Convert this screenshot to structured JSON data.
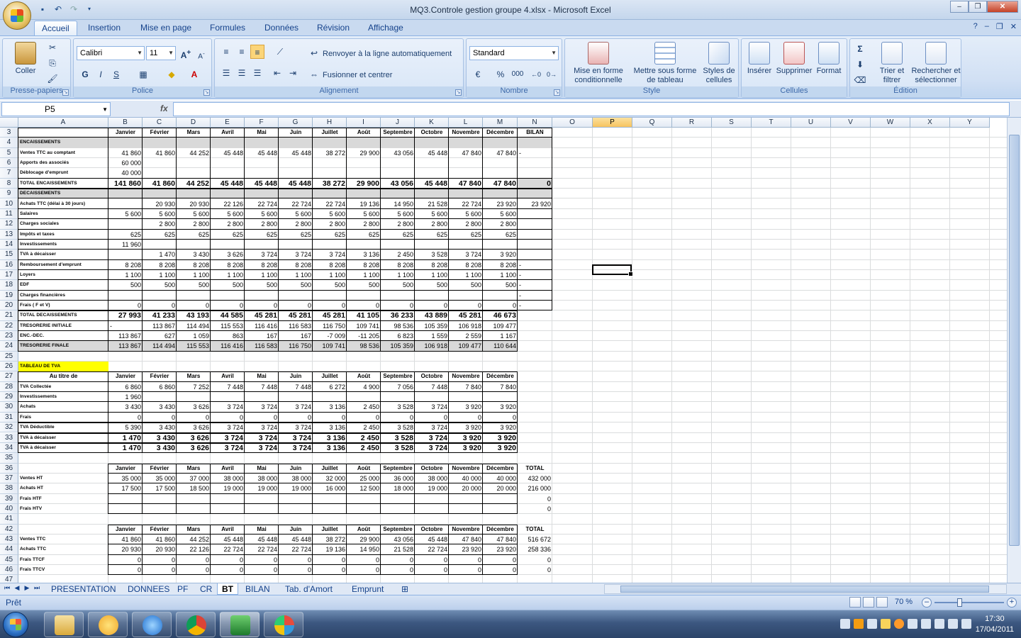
{
  "window": {
    "title": "MQ3.Controle gestion groupe 4.xlsx - Microsoft Excel"
  },
  "ribbon": {
    "tabs": [
      "Accueil",
      "Insertion",
      "Mise en page",
      "Formules",
      "Données",
      "Révision",
      "Affichage"
    ],
    "active_tab": "Accueil",
    "groups": {
      "clipboard": "Presse-papiers",
      "font": "Police",
      "alignment": "Alignement",
      "number": "Nombre",
      "style": "Style",
      "cells": "Cellules",
      "editing": "Édition"
    },
    "paste_label": "Coller",
    "font_name": "Calibri",
    "font_size": "11",
    "wrap_text": "Renvoyer à la ligne automatiquement",
    "merge_center": "Fusionner et centrer",
    "number_format": "Standard",
    "conditional_l1": "Mise en forme",
    "conditional_l2": "conditionnelle",
    "table_l1": "Mettre sous forme",
    "table_l2": "de tableau",
    "cellstyles_l1": "Styles de",
    "cellstyles_l2": "cellules",
    "insert": "Insérer",
    "delete": "Supprimer",
    "format": "Format",
    "sort_l1": "Trier et",
    "sort_l2": "filtrer",
    "find_l1": "Rechercher et",
    "find_l2": "sélectionner",
    "bold": "G",
    "italic": "I",
    "underline": "S",
    "percent": "%",
    "thousands": "000",
    "autosum": "Σ"
  },
  "formula_bar": {
    "name_box": "P5",
    "fx": "fx",
    "formula": ""
  },
  "columns": [
    "A",
    "B",
    "C",
    "D",
    "E",
    "F",
    "G",
    "H",
    "I",
    "J",
    "K",
    "L",
    "M",
    "N",
    "O",
    "P",
    "Q",
    "R",
    "S",
    "T",
    "U",
    "V",
    "W",
    "X",
    "Y"
  ],
  "selected_column": "P",
  "rows": [
    {
      "n": 3,
      "cells": {
        "B": "Janvier",
        "C": "Février",
        "D": "Mars",
        "E": "Avril",
        "F": "Mai",
        "G": "Juin",
        "H": "Juillet",
        "I": "Août",
        "J": "Septembre",
        "K": "Octobre",
        "L": "Novembre",
        "M": "Décembre",
        "N": "BILAN"
      },
      "hdr": true
    },
    {
      "n": 4,
      "cells": {
        "A": "ENCAISSEMENTS"
      }
    },
    {
      "n": 5,
      "cells": {
        "A": "Ventes TTC au comptant",
        "B": "41 860",
        "C": "41 860",
        "D": "44 252",
        "E": "45 448",
        "F": "45 448",
        "G": "45 448",
        "H": "38 272",
        "I": "29 900",
        "J": "43 056",
        "K": "45 448",
        "L": "47 840",
        "M": "47 840",
        "N": "-"
      }
    },
    {
      "n": 6,
      "cells": {
        "A": "Apports des associés",
        "B": "60 000"
      }
    },
    {
      "n": 7,
      "cells": {
        "A": "Déblocage d'emprunt",
        "B": "40 000"
      }
    },
    {
      "n": 8,
      "cells": {
        "A": "TOTAL ENCAISSEMENTS",
        "B": "141 860",
        "C": "41 860",
        "D": "44 252",
        "E": "45 448",
        "F": "45 448",
        "G": "45 448",
        "H": "38 272",
        "I": "29 900",
        "J": "43 056",
        "K": "45 448",
        "L": "47 840",
        "M": "47 840",
        "N": "0"
      },
      "bold": true
    },
    {
      "n": 9,
      "cells": {
        "A": "DECAISSEMENTS"
      }
    },
    {
      "n": 10,
      "cells": {
        "A": "Achats TTC (délai à 30 jours)",
        "C": "20 930",
        "D": "20 930",
        "E": "22 126",
        "F": "22 724",
        "G": "22 724",
        "H": "22 724",
        "I": "19 136",
        "J": "14 950",
        "K": "21 528",
        "L": "22 724",
        "M": "23 920",
        "N": "23 920"
      }
    },
    {
      "n": 11,
      "cells": {
        "A": "Salaires",
        "B": "5 600",
        "C": "5 600",
        "D": "5 600",
        "E": "5 600",
        "F": "5 600",
        "G": "5 600",
        "H": "5 600",
        "I": "5 600",
        "J": "5 600",
        "K": "5 600",
        "L": "5 600",
        "M": "5 600"
      }
    },
    {
      "n": 12,
      "cells": {
        "A": "Charges sociales",
        "C": "2 800",
        "D": "2 800",
        "E": "2 800",
        "F": "2 800",
        "G": "2 800",
        "H": "2 800",
        "I": "2 800",
        "J": "2 800",
        "K": "2 800",
        "L": "2 800",
        "M": "2 800"
      }
    },
    {
      "n": 13,
      "cells": {
        "A": "Impôts et taxes",
        "B": "625",
        "C": "625",
        "D": "625",
        "E": "625",
        "F": "625",
        "G": "625",
        "H": "625",
        "I": "625",
        "J": "625",
        "K": "625",
        "L": "625",
        "M": "625"
      }
    },
    {
      "n": 14,
      "cells": {
        "A": "Investissements",
        "B": "11 960"
      }
    },
    {
      "n": 15,
      "cells": {
        "A": "TVA à décaisser",
        "C": "1 470",
        "D": "3 430",
        "E": "3 626",
        "F": "3 724",
        "G": "3 724",
        "H": "3 724",
        "I": "3 136",
        "J": "2 450",
        "K": "3 528",
        "L": "3 724",
        "M": "3 920"
      }
    },
    {
      "n": 16,
      "cells": {
        "A": "Remboursement d'emprunt",
        "B": "8 208",
        "C": "8 208",
        "D": "8 208",
        "E": "8 208",
        "F": "8 208",
        "G": "8 208",
        "H": "8 208",
        "I": "8 208",
        "J": "8 208",
        "K": "8 208",
        "L": "8 208",
        "M": "8 208",
        "N": "-"
      }
    },
    {
      "n": 17,
      "cells": {
        "A": "Loyers",
        "B": "1 100",
        "C": "1 100",
        "D": "1 100",
        "E": "1 100",
        "F": "1 100",
        "G": "1 100",
        "H": "1 100",
        "I": "1 100",
        "J": "1 100",
        "K": "1 100",
        "L": "1 100",
        "M": "1 100",
        "N": "-"
      }
    },
    {
      "n": 18,
      "cells": {
        "A": "EDF",
        "B": "500",
        "C": "500",
        "D": "500",
        "E": "500",
        "F": "500",
        "G": "500",
        "H": "500",
        "I": "500",
        "J": "500",
        "K": "500",
        "L": "500",
        "M": "500",
        "N": "-"
      }
    },
    {
      "n": 19,
      "cells": {
        "A": "Charges financières",
        "N": "-"
      }
    },
    {
      "n": 20,
      "cells": {
        "A": "Frais ( F et V)",
        "B": "0",
        "C": "0",
        "D": "0",
        "E": "0",
        "F": "0",
        "G": "0",
        "H": "0",
        "I": "0",
        "J": "0",
        "K": "0",
        "L": "0",
        "M": "0",
        "N": "-"
      }
    },
    {
      "n": 21,
      "cells": {
        "A": "TOTAL DECAISSEMENTS",
        "B": "27 993",
        "C": "41 233",
        "D": "43 193",
        "E": "44 585",
        "F": "45 281",
        "G": "45 281",
        "H": "45 281",
        "I": "41 105",
        "J": "36 233",
        "K": "43 889",
        "L": "45 281",
        "M": "46 673"
      },
      "bold": true
    },
    {
      "n": 22,
      "cells": {
        "A": "TRESORERIE INITIALE",
        "B": "-",
        "C": "113 867",
        "D": "114 494",
        "E": "115 553",
        "F": "116 416",
        "G": "116 583",
        "H": "116 750",
        "I": "109 741",
        "J": "98 536",
        "K": "105 359",
        "L": "106 918",
        "M": "109 477"
      }
    },
    {
      "n": 23,
      "cells": {
        "A": "ENC.-DEC.",
        "B": "113 867",
        "C": "627",
        "D": "1 059",
        "E": "863",
        "F": "167",
        "G": "167",
        "H": "-7 009",
        "I": "-11 205",
        "J": "6 823",
        "K": "1 559",
        "L": "2 559",
        "M": "1 167"
      }
    },
    {
      "n": 24,
      "cells": {
        "A": "TRESORERIE FINALE",
        "B": "113 867",
        "C": "114 494",
        "D": "115 553",
        "E": "116 416",
        "F": "116 583",
        "G": "116 750",
        "H": "109 741",
        "I": "98 536",
        "J": "105 359",
        "K": "106 918",
        "L": "109 477",
        "M": "110 644"
      },
      "gray": true
    },
    {
      "n": 25,
      "cells": {}
    },
    {
      "n": 26,
      "cells": {
        "A": "TABLEAU DE TVA"
      }
    },
    {
      "n": 27,
      "cells": {
        "A": "Au titre de",
        "B": "Janvier",
        "C": "Février",
        "D": "Mars",
        "E": "Avril",
        "F": "Mai",
        "G": "Juin",
        "H": "Juillet",
        "I": "Août",
        "J": "Septembre",
        "K": "Octobre",
        "L": "Novembre",
        "M": "Décembre"
      },
      "hdr": true
    },
    {
      "n": 28,
      "cells": {
        "A": "TVA Collectée",
        "B": "6 860",
        "C": "6 860",
        "D": "7 252",
        "E": "7 448",
        "F": "7 448",
        "G": "7 448",
        "H": "6 272",
        "I": "4 900",
        "J": "7 056",
        "K": "7 448",
        "L": "7 840",
        "M": "7 840"
      }
    },
    {
      "n": 29,
      "cells": {
        "A": "Investissements",
        "B": "1 960"
      }
    },
    {
      "n": 30,
      "cells": {
        "A": "Achats",
        "B": "3 430",
        "C": "3 430",
        "D": "3 626",
        "E": "3 724",
        "F": "3 724",
        "G": "3 724",
        "H": "3 136",
        "I": "2 450",
        "J": "3 528",
        "K": "3 724",
        "L": "3 920",
        "M": "3 920"
      }
    },
    {
      "n": 31,
      "cells": {
        "A": "Frais",
        "B": "0",
        "C": "0",
        "D": "0",
        "E": "0",
        "F": "0",
        "G": "0",
        "H": "0",
        "I": "0",
        "J": "0",
        "K": "0",
        "L": "0",
        "M": "0"
      }
    },
    {
      "n": 32,
      "cells": {
        "A": "TVA Déductible",
        "B": "5 390",
        "C": "3 430",
        "D": "3 626",
        "E": "3 724",
        "F": "3 724",
        "G": "3 724",
        "H": "3 136",
        "I": "2 450",
        "J": "3 528",
        "K": "3 724",
        "L": "3 920",
        "M": "3 920"
      }
    },
    {
      "n": 33,
      "cells": {
        "A": "TVA à décaisser",
        "B": "1 470",
        "C": "3 430",
        "D": "3 626",
        "E": "3 724",
        "F": "3 724",
        "G": "3 724",
        "H": "3 136",
        "I": "2 450",
        "J": "3 528",
        "K": "3 724",
        "L": "3 920",
        "M": "3 920"
      },
      "bold": true
    },
    {
      "n": 34,
      "cells": {
        "A": "TVA à décaisser",
        "B": "1 470",
        "C": "3 430",
        "D": "3 626",
        "E": "3 724",
        "F": "3 724",
        "G": "3 724",
        "H": "3 136",
        "I": "2 450",
        "J": "3 528",
        "K": "3 724",
        "L": "3 920",
        "M": "3 920"
      },
      "bold": true
    },
    {
      "n": 35,
      "cells": {}
    },
    {
      "n": 36,
      "cells": {
        "B": "Janvier",
        "C": "Février",
        "D": "Mars",
        "E": "Avril",
        "F": "Mai",
        "G": "Juin",
        "H": "Juillet",
        "I": "Août",
        "J": "Septembre",
        "K": "Octobre",
        "L": "Novembre",
        "M": "Décembre",
        "N": "TOTAL"
      },
      "hdr": true
    },
    {
      "n": 37,
      "cells": {
        "A": "Ventes HT",
        "B": "35 000",
        "C": "35 000",
        "D": "37 000",
        "E": "38 000",
        "F": "38 000",
        "G": "38 000",
        "H": "32 000",
        "I": "25 000",
        "J": "36 000",
        "K": "38 000",
        "L": "40 000",
        "M": "40 000",
        "N": "432 000"
      }
    },
    {
      "n": 38,
      "cells": {
        "A": "Achats HT",
        "B": "17 500",
        "C": "17 500",
        "D": "18 500",
        "E": "19 000",
        "F": "19 000",
        "G": "19 000",
        "H": "16 000",
        "I": "12 500",
        "J": "18 000",
        "K": "19 000",
        "L": "20 000",
        "M": "20 000",
        "N": "216 000"
      }
    },
    {
      "n": 39,
      "cells": {
        "A": "Frais HTF",
        "N": "0"
      }
    },
    {
      "n": 40,
      "cells": {
        "A": "Frais HTV",
        "N": "0"
      }
    },
    {
      "n": 41,
      "cells": {}
    },
    {
      "n": 42,
      "cells": {
        "B": "Janvier",
        "C": "Février",
        "D": "Mars",
        "E": "Avril",
        "F": "Mai",
        "G": "Juin",
        "H": "Juillet",
        "I": "Août",
        "J": "Septembre",
        "K": "Octobre",
        "L": "Novembre",
        "M": "Décembre",
        "N": "TOTAL"
      },
      "hdr": true
    },
    {
      "n": 43,
      "cells": {
        "A": "Ventes TTC",
        "B": "41 860",
        "C": "41 860",
        "D": "44 252",
        "E": "45 448",
        "F": "45 448",
        "G": "45 448",
        "H": "38 272",
        "I": "29 900",
        "J": "43 056",
        "K": "45 448",
        "L": "47 840",
        "M": "47 840",
        "N": "516 672"
      }
    },
    {
      "n": 44,
      "cells": {
        "A": "Achats TTC",
        "B": "20 930",
        "C": "20 930",
        "D": "22 126",
        "E": "22 724",
        "F": "22 724",
        "G": "22 724",
        "H": "19 136",
        "I": "14 950",
        "J": "21 528",
        "K": "22 724",
        "L": "23 920",
        "M": "23 920",
        "N": "258 336"
      }
    },
    {
      "n": 45,
      "cells": {
        "A": "Frais TTCF",
        "B": "0",
        "C": "0",
        "D": "0",
        "E": "0",
        "F": "0",
        "G": "0",
        "H": "0",
        "I": "0",
        "J": "0",
        "K": "0",
        "L": "0",
        "M": "0",
        "N": "0"
      }
    },
    {
      "n": 46,
      "cells": {
        "A": "Frais TTCV",
        "B": "0",
        "C": "0",
        "D": "0",
        "E": "0",
        "F": "0",
        "G": "0",
        "H": "0",
        "I": "0",
        "J": "0",
        "K": "0",
        "L": "0",
        "M": "0",
        "N": "0"
      }
    },
    {
      "n": 47,
      "cells": {}
    }
  ],
  "sheet_tabs": [
    "PRESENTATION",
    "DONNEES",
    "PF",
    "CR",
    "BT",
    "BILAN",
    "Tab. d'Amort",
    "Emprunt"
  ],
  "active_sheet": "BT",
  "status": {
    "ready": "Prêt",
    "zoom": "70 %"
  },
  "taskbar": {
    "time": "17:30",
    "date": "17/04/2011"
  },
  "colors": {
    "highlight": "#ffff00",
    "total_fill": "#d9d9d9",
    "selected_header": "#f7c35f"
  }
}
